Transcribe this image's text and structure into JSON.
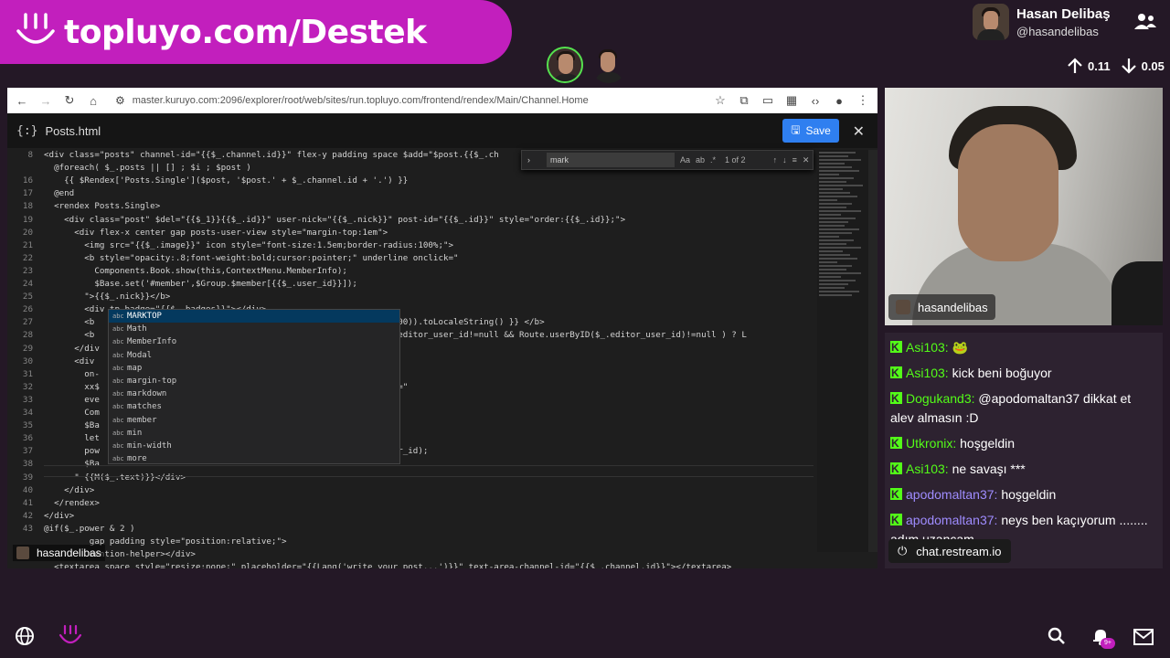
{
  "banner": {
    "text": "topluyo.com/Destek"
  },
  "profile": {
    "name": "Hasan Delibaş",
    "handle": "@hasandelibas"
  },
  "stats": {
    "up": "0.11",
    "down": "0.05"
  },
  "browser": {
    "url": "master.kuruyo.com:2096/explorer/root/web/sites/run.topluyo.com/frontend/rendex/Main/Channel.Home"
  },
  "editor": {
    "braces": "{:}",
    "filename": "Posts.html",
    "save_label": "Save",
    "find": {
      "query": "mark",
      "aa": "Aa",
      "ab": "ab",
      "count": "1 of 2"
    },
    "lines": [
      {
        "n": "8",
        "code": "<div class=\"posts\" channel-id=\"{{$_.channel.id}}\" flex-y padding space $add=\"$post.{{$_.ch"
      },
      {
        "n": "",
        "code": "  @foreach( $_.posts || [] ; $i ; $post )"
      },
      {
        "n": "16",
        "code": "    {{ $Rendex['Posts.Single']($post, '$post.' + $_.channel.id + '.') }}"
      },
      {
        "n": "17",
        "code": "  @end"
      },
      {
        "n": "18",
        "code": "  <rendex Posts.Single>"
      },
      {
        "n": "19",
        "code": "    <div class=\"post\" $del=\"{{$_1}}{{$_.id}}\" user-nick=\"{{$_.nick}}\" post-id=\"{{$_.id}}\" style=\"order:{{$_.id}};\">"
      },
      {
        "n": "20",
        "code": "      <div flex-x center gap posts-user-view style=\"margin-top:1em\">"
      },
      {
        "n": "21",
        "code": "        <img src=\"{{$_.image}}\" icon style=\"font-size:1.5em;border-radius:100%;\">"
      },
      {
        "n": "22",
        "code": "        <b style=\"opacity:.8;font-weight:bold;cursor:pointer;\" underline onclick=\""
      },
      {
        "n": "23",
        "code": "          Components.Book.show(this,ContextMenu.MemberInfo);"
      },
      {
        "n": "24",
        "code": "          $Base.set('#member',$Group.$member[{{$_.user_id}}]);"
      },
      {
        "n": "25",
        "code": "        \">{{$_.nick}}</b>"
      },
      {
        "n": "26",
        "code": "        <div tp-badge=\"{{$_.badges}}\"></div>"
      },
      {
        "n": "27",
        "code": "        <b                                                  ated_at*1000)).toLocaleString() }} </b>"
      },
      {
        "n": "28",
        "code": "        <b                                                  !=0 && $_.editor_user_id!=null && Route.userByID($_.editor_user_id)!=null ) ? L"
      },
      {
        "n": "29",
        "code": "      </div"
      },
      {
        "n": "30",
        "code": "      <div"
      },
      {
        "n": "31",
        "code": "        on-                                              lue)\""
      },
      {
        "n": "32",
        "code": "        xx$                                              oncontextmenu=\""
      },
      {
        "n": "33",
        "code": "        eve"
      },
      {
        "n": "34",
        "code": "        Com                                              u.PostEdit);"
      },
      {
        "n": "35",
        "code": "        $Ba"
      },
      {
        "n": "36",
        "code": "        let"
      },
      {
        "n": "37",
        "code": "        pow                                              '#post')).user_id);"
      },
      {
        "n": "38",
        "code": "        $Ba"
      },
      {
        "n": "39",
        "code": "      \" {{M($_.text)}}</div>"
      },
      {
        "n": "40",
        "code": "    </div>"
      },
      {
        "n": "41",
        "code": "  </rendex>"
      },
      {
        "n": "42",
        "code": "</div>"
      },
      {
        "n": "43",
        "code": "@if($_.power & 2 )"
      },
      {
        "n": "",
        "code": "         gap padding style=\"position:relative;\">"
      },
      {
        "n": "",
        "code": "         mention-helper></div>"
      },
      {
        "n": "",
        "code": "  <textarea space style=\"resize:none;\" placeholder=\"{{Lang('write your post...')}}\" text-area-channel-id=\"{{$_.channel.id}}\"></textarea>"
      }
    ],
    "suggestions": [
      "MARKTOP",
      "Math",
      "MemberInfo",
      "Modal",
      "map",
      "margin-top",
      "markdown",
      "matches",
      "member",
      "min",
      "min-width",
      "more"
    ],
    "suggest_kind": "abc"
  },
  "presenter": {
    "name": "hasandelibas"
  },
  "cam": {
    "name": "hasandelibas"
  },
  "chat": {
    "messages": [
      {
        "user": "Asi103:",
        "text": "🐸",
        "color": "green"
      },
      {
        "user": "Asi103:",
        "text": "kick beni boğuyor",
        "color": "green"
      },
      {
        "user": "Dogukand3:",
        "text": "@apodomaltan37 dikkat et alev almasın :D",
        "color": "green"
      },
      {
        "user": "Utkronix:",
        "text": "hoşgeldin",
        "color": "green"
      },
      {
        "user": "Asi103:",
        "text": "ne savaşı ***",
        "color": "green"
      },
      {
        "user": "apodomaltan37:",
        "text": "hoşgeldin",
        "color": "purple"
      },
      {
        "user": "apodomaltan37:",
        "text": "neys ben kaçıyorum ........ adım uzancam",
        "color": "purple"
      }
    ],
    "source": "chat.restream.io"
  },
  "bottom": {
    "badge": "9+"
  },
  "colors": {
    "brand": "#c21fbd",
    "kick": "#53fc18",
    "save": "#2f7ff0"
  }
}
